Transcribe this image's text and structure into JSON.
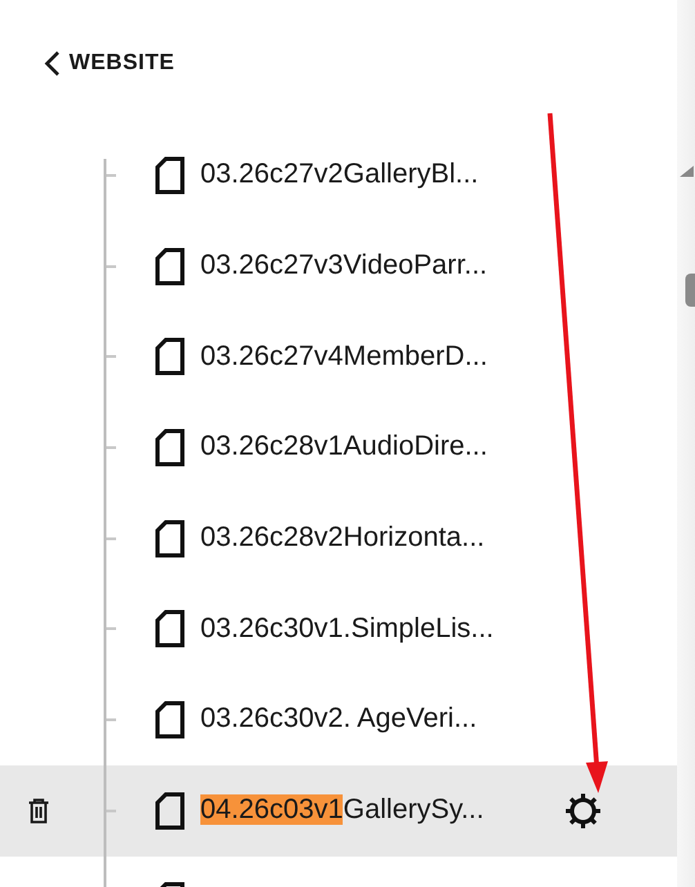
{
  "header": {
    "back_label": "WEBSITE"
  },
  "pages": [
    {
      "label": "03.26c27v2GalleryBl...",
      "selected": false
    },
    {
      "label": "03.26c27v3VideoParr...",
      "selected": false
    },
    {
      "label": "03.26c27v4MemberD...",
      "selected": false
    },
    {
      "label": "03.26c28v1AudioDire...",
      "selected": false
    },
    {
      "label": "03.26c28v2Horizonta...",
      "selected": false
    },
    {
      "label": "03.26c30v1.SimpleLis...",
      "selected": false
    },
    {
      "label": "03.26c30v2. AgeVeri...",
      "selected": false
    },
    {
      "highlight": "04.26c03v1",
      "label": "GallerySy...",
      "selected": true
    },
    {
      "selected": false
    }
  ]
}
